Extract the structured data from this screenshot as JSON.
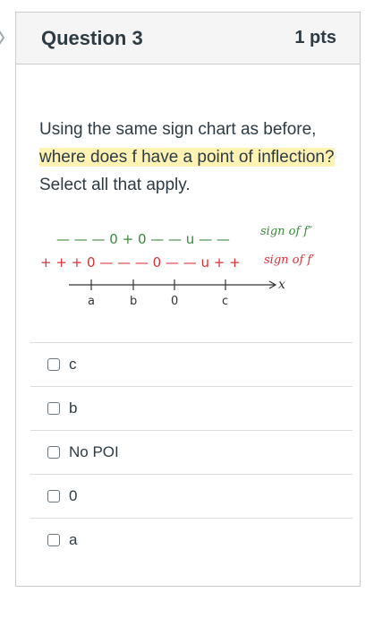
{
  "question": {
    "title": "Question 3",
    "points": "1 pts",
    "text_part1": "Using the same sign chart as before, ",
    "text_highlight": "where does f have a point of inflection?",
    "text_part2": " Select all that apply."
  },
  "sign_chart": {
    "row1_signs": "— — — 0 + 0 — — u — —",
    "row1_label": "sign of f″",
    "row2_signs": "+ + + 0 — — — 0 — — u + +",
    "row2_label": "sign of f′",
    "axis_label": "x",
    "tick_labels": [
      "a",
      "b",
      "0",
      "c"
    ],
    "colors": {
      "row1": "#3a8a3a",
      "row2": "#d8333a",
      "axis": "#333333"
    }
  },
  "answers": [
    {
      "label": "c",
      "checked": false
    },
    {
      "label": "b",
      "checked": false
    },
    {
      "label": "No POI",
      "checked": false
    },
    {
      "label": "0",
      "checked": false
    },
    {
      "label": "a",
      "checked": false
    }
  ]
}
